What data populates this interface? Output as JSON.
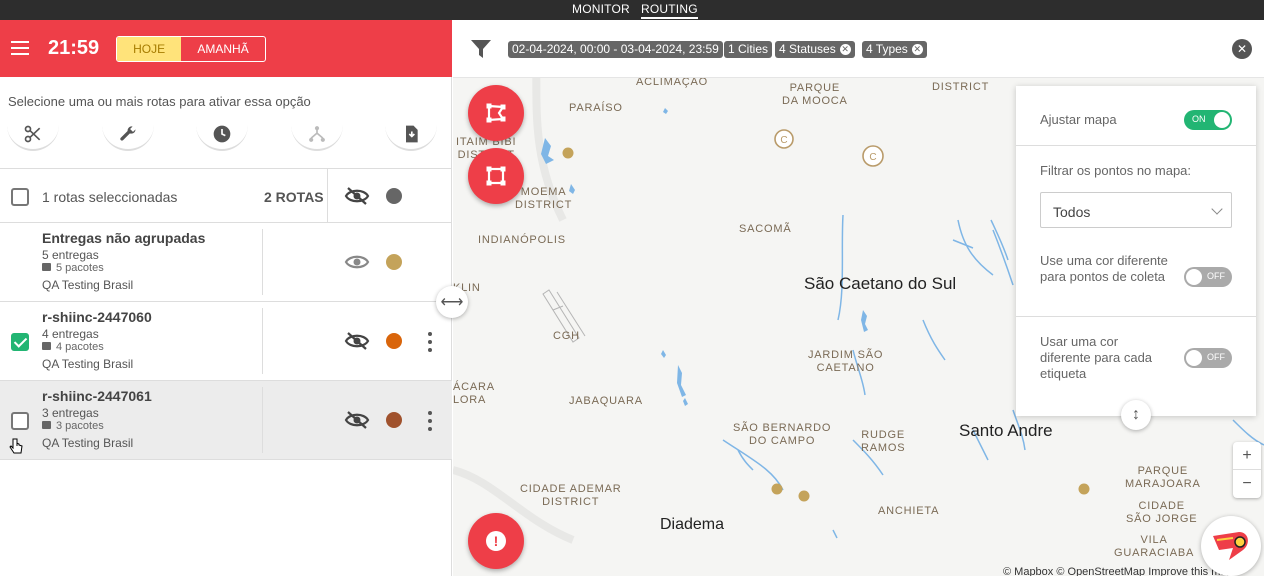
{
  "topnav": {
    "tabs": [
      {
        "label": "MONITOR"
      },
      {
        "label": "ROUTING"
      }
    ]
  },
  "header": {
    "time": "21:59",
    "today_label": "HOJE",
    "tomorrow_label": "AMANHÃ"
  },
  "hint": "Selecione uma ou mais rotas para ativar essa opção",
  "toolbar": {
    "icons": [
      "scissors-icon",
      "wrench-icon",
      "clock-icon",
      "route-icon",
      "download-icon"
    ]
  },
  "selection": {
    "count_label": "1 rotas seleccionadas",
    "routes_label": "2 ROTAS",
    "dot_color": "#666666"
  },
  "routes": [
    {
      "name": "Entregas não agrupadas",
      "deliveries": "5 entregas",
      "packages": "5 pacotes",
      "company": "QA Testing Brasil",
      "color": "#c4a35a",
      "checked": false,
      "visible": true
    },
    {
      "name": "r-shiinc-2447060",
      "deliveries": "4 entregas",
      "packages": "4 pacotes",
      "company": "QA Testing Brasil",
      "color": "#d9650b",
      "checked": true,
      "visible": false
    },
    {
      "name": "r-shiinc-2447061",
      "deliveries": "3 entregas",
      "packages": "3 pacotes",
      "company": "QA Testing Brasil",
      "color": "#a0522d",
      "checked": false,
      "visible": false
    }
  ],
  "map": {
    "chips": [
      {
        "label": "02-04-2024, 00:00 - 03-04-2024, 23:59",
        "closable": false
      },
      {
        "label": "1 Cities",
        "closable": false
      },
      {
        "label": "4 Statuses",
        "closable": true
      },
      {
        "label": "4 Types",
        "closable": true
      }
    ],
    "labels": {
      "aclimacao": "ACLIMAÇÃO",
      "parque_mooca": "PARQUE\nDA MOOCA",
      "district_top": "DISTRICT",
      "paraiso": "PARAÍSO",
      "itaim": "ITAIM BIBI\nDISTRICT",
      "moema": "MOEMA\nDISTRICT",
      "indianopolis": "INDIANÓPOLIS",
      "sacoma": "SACOMÃ",
      "sao_caetano": "São Caetano do Sul",
      "klin": "KLIN",
      "cgh": "CGH",
      "jardim_sao_caetano": "JARDIM SÃO\nCAETANO",
      "alcacara": "ÁCARA\nLORA",
      "jabaquara": "JABAQUARA",
      "sao_bernardo": "SÃO BERNARDO\nDO CAMPO",
      "rudge_ramos": "RUDGE\nRAMOS",
      "santo_andre": "Santo Andre",
      "cidade_ademar": "CIDADE ADEMAR\nDISTRICT",
      "anchieta": "ANCHIETA",
      "diadema": "Diadema",
      "parque_marajoara": "PARQUE\nMARAJOARA",
      "cidade_sao_jorge": "CIDADE\nSÃO JORGE",
      "vila_guaraciaba": "VILA\nGUARACIABA"
    },
    "attribution": "© Mapbox © OpenStreetMap  Improve this map",
    "zoom_in": "+",
    "zoom_out": "−"
  },
  "settings": {
    "adjust_map_label": "Ajustar mapa",
    "adjust_map_state": "ON",
    "filter_label": "Filtrar os pontos no mapa:",
    "filter_value": "Todos",
    "collect_color_label": "Use uma cor diferente para pontos de coleta",
    "collect_color_state": "OFF",
    "tag_color_label": "Usar uma cor diferente para cada etiqueta",
    "tag_color_state": "OFF"
  },
  "fab": {
    "alert_glyph": "!"
  }
}
